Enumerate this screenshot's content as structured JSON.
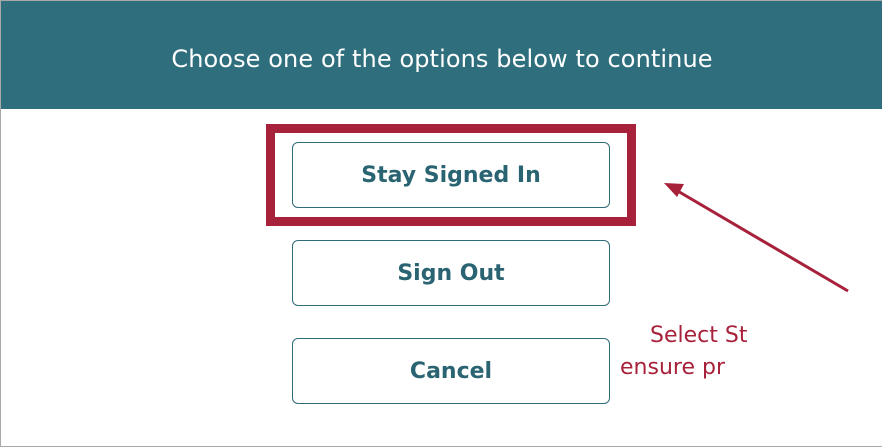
{
  "dialog": {
    "prompt": "Choose one of the options below to continue",
    "buttons": {
      "stay_signed_in": "Stay Signed In",
      "sign_out": "Sign Out",
      "cancel": "Cancel"
    }
  },
  "annotation": {
    "line1": "Select St",
    "line2": "ensure pr",
    "color": "#a8213b"
  },
  "colors": {
    "header_bg": "#2e6e7d",
    "button_text": "#2a6371"
  }
}
